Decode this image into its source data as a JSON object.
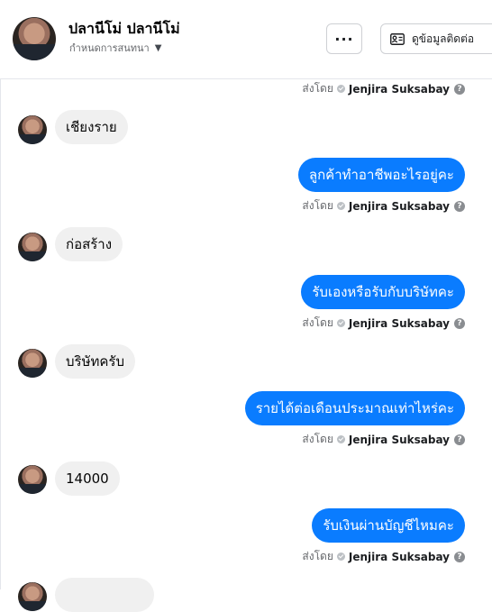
{
  "header": {
    "name": "ปลานีโม่ ปลานีโม่",
    "subtitle": "กำหนดการสนทนา",
    "more_label": "···",
    "contact_label": "ดูข้อมูลติดต่อ"
  },
  "sent_by_prefix": "ส่งโดย",
  "agent_name": "Jenjira Suksabay",
  "messages": [
    {
      "dir": "in",
      "text": "เชียงราย"
    },
    {
      "dir": "out",
      "text": "ลูกค้าทำอาชีพอะไรอยู่คะ"
    },
    {
      "dir": "in",
      "text": "ก่อสร้าง"
    },
    {
      "dir": "out",
      "text": "รับเองหรือรับกับบริษัทคะ"
    },
    {
      "dir": "in",
      "text": "บริษัทครับ"
    },
    {
      "dir": "out",
      "text": "รายได้ต่อเดือนประมาณเท่าไหร่คะ"
    },
    {
      "dir": "in",
      "text": "14000"
    },
    {
      "dir": "out",
      "text": "รับเงินผ่านบัญชีไหมคะ"
    }
  ],
  "colors": {
    "outgoing_bubble": "#0a7cff",
    "incoming_bubble": "#f0f0f0",
    "muted_text": "#65676b"
  }
}
